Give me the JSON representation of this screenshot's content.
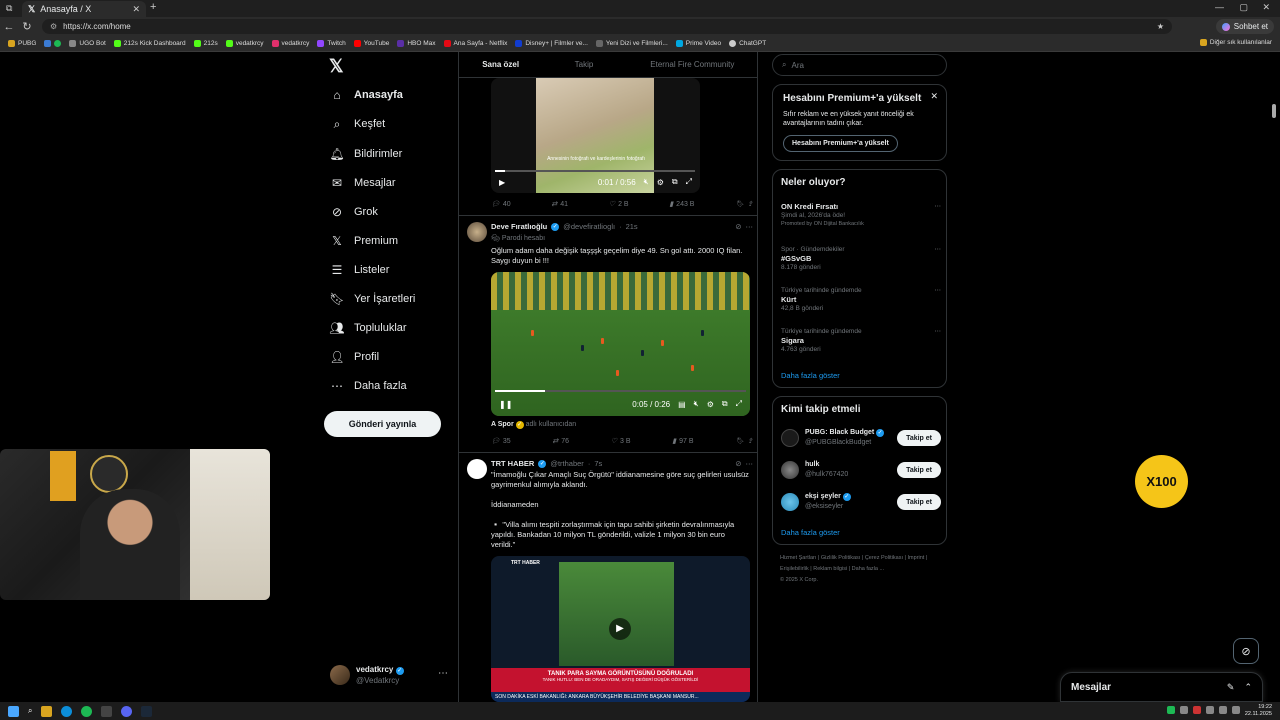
{
  "browser": {
    "tab_title": "Anasayfa / X",
    "url": "https://x.com/home",
    "sohbet_label": "Sohbet et",
    "bookmarks": [
      "PUBG",
      "UGO Bot",
      "212s Kick Dashboard",
      "212s",
      "vedatkrcy",
      "vedatkrcy",
      "Twitch",
      "YouTube",
      "HBO Max",
      "Ana Sayfa - Netflix",
      "Disney+ | Filmler ve...",
      "Yeni Dizi ve Filmleri...",
      "Prime Video",
      "ChatGPT"
    ],
    "other_bookmarks": "Diğer sık kullanılanlar"
  },
  "sidebar": {
    "items": [
      {
        "label": "Anasayfa",
        "icon": "home-icon"
      },
      {
        "label": "Keşfet",
        "icon": "search-icon"
      },
      {
        "label": "Bildirimler",
        "icon": "bell-icon"
      },
      {
        "label": "Mesajlar",
        "icon": "mail-icon"
      },
      {
        "label": "Grok",
        "icon": "grok-icon"
      },
      {
        "label": "Premium",
        "icon": "x-icon"
      },
      {
        "label": "Listeler",
        "icon": "list-icon"
      },
      {
        "label": "Yer İşaretleri",
        "icon": "bookmark-icon"
      },
      {
        "label": "Topluluklar",
        "icon": "people-icon"
      },
      {
        "label": "Profil",
        "icon": "person-icon"
      },
      {
        "label": "Daha fazla",
        "icon": "more-icon"
      }
    ],
    "post_button": "Gönderi yayınla",
    "profile_name": "vedatkrcy",
    "profile_handle": "@Vedatkrcy"
  },
  "feed": {
    "tabs": [
      "Sana özel",
      "Takip",
      "Eternal Fire Community"
    ],
    "post1": {
      "video_time": "0:01 / 0:56",
      "overlay_text": "Annesinin fotoğrafı ve kardeşlerinin fotoğrafı",
      "replies": "40",
      "reposts": "41",
      "likes": "2 B",
      "views": "243 B"
    },
    "post2": {
      "name": "Deve Fıratlıoğlu",
      "handle": "@devefiratlioglı",
      "time": "21s",
      "label": "Parodi hesabı",
      "text": "Oğlum adam daha değişik taşşşk geçelim diye 49. Sn gol attı. 2000 IQ filan. Saygı duyun bi !!!",
      "video_time": "0:05 / 0:26",
      "source": "A Spor",
      "source_extra": "adlı kullanıcıdan",
      "replies": "35",
      "reposts": "76",
      "likes": "3 B",
      "views": "97 B"
    },
    "post3": {
      "name": "TRT HABER",
      "handle": "@trthaber",
      "time": "7s",
      "text1": "\"İmamoğlu Çıkar Amaçlı Suç Örgütü\" iddianamesine göre suç gelirleri usulsüz gayrimenkul alımıyla aklandı.",
      "text2": "İddianameden",
      "text3": "▫️ \"Villa alımı tespiti zorlaştırmak için tapu sahibi şirketin devralınmasıyla yapıldı. Bankadan 10 milyon TL gönderildi, valizle 1 milyon 30 bin euro verildi.\"",
      "video_brand": "TRT HABER",
      "banner_line1": "TANIK PARA SAYMA GÖRÜNTÜSÜNÜ DOĞRULADI",
      "banner_line2": "TANIK HUTLU: BEN DE ORADAYDIM, SATIŞ DEĞERİ DÜŞÜK GÖSTERİLDİ",
      "ticker": "SON DAKİKA  ESKİ BAKANLIĞI: ANKARA BÜYÜKŞEHİR BELEDİYE BAŞKANI MANSUR..."
    }
  },
  "right": {
    "search_placeholder": "Ara",
    "premium": {
      "title": "Hesabını Premium+'a yükselt",
      "text": "Sıfır reklam ve en yüksek yanıt önceliği ek avantajlarının tadını çıkar.",
      "button": "Hesabını Premium+'a yükselt"
    },
    "trends": {
      "title": "Neler oluyor?",
      "items": [
        {
          "cat": "",
          "name": "ON Kredi Fırsatı",
          "sub": "Şimdi al, 2026'da öde!",
          "extra": "Promoted by ON Dijital Bankacılık"
        },
        {
          "cat": "Spor · Gündemdekiler",
          "name": "#GSvGB",
          "sub": "8.178 gönderi",
          "extra": ""
        },
        {
          "cat": "Türkiye tarihinde gündemde",
          "name": "Kürt",
          "sub": "42,8 B gönderi",
          "extra": ""
        },
        {
          "cat": "Türkiye tarihinde gündemde",
          "name": "Sigara",
          "sub": "4.763 gönderi",
          "extra": ""
        }
      ],
      "more": "Daha fazla göster"
    },
    "who_to_follow": {
      "title": "Kimi takip etmeli",
      "items": [
        {
          "name": "PUBG: Black Budget",
          "handle": "@PUBGBlackBudget",
          "button": "Takip et"
        },
        {
          "name": "hulk",
          "handle": "@hulk767420",
          "button": "Takip et"
        },
        {
          "name": "ekşi şeyler",
          "handle": "@eksiseyler",
          "button": "Takip et"
        }
      ],
      "more": "Daha fazla göster"
    },
    "footer": [
      "Hizmet Şartları",
      "Gizlilik Politikası",
      "Çerez Politikası",
      "Imprint",
      "Erişilebilirlik",
      "Reklam bilgisi",
      "Daha fazla ...",
      "© 2025 X Corp."
    ]
  },
  "overlay": {
    "x100_label": "X100",
    "messages_label": "Mesajlar"
  },
  "taskbar": {
    "time": "19:22",
    "date": "22.11.2025"
  }
}
